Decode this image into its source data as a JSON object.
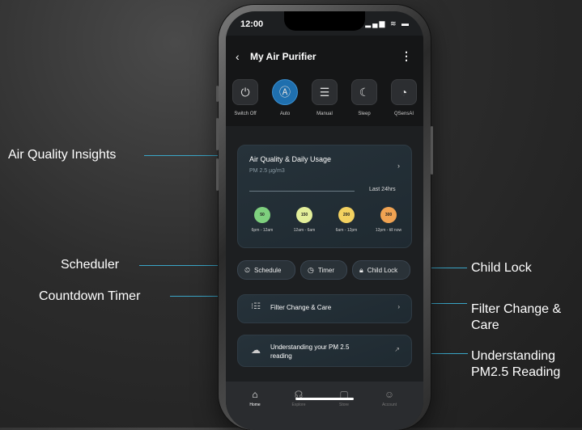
{
  "callouts": {
    "air_quality": "Air Quality Insights",
    "scheduler": "Scheduler",
    "countdown": "Countdown Timer",
    "child_lock": "Child Lock",
    "filter_line1": "Filter Change &",
    "filter_line2": "Care",
    "pm_line1": "Understanding",
    "pm_line2": "PM2.5 Reading"
  },
  "status": {
    "time": "12:00",
    "icons": "▂▄▆ ≋ ▬"
  },
  "header": {
    "back": "‹",
    "title": "My Air Purifier",
    "more": "⋮"
  },
  "modes": [
    {
      "label": "Switch Off",
      "icon": "⏻",
      "icon_name": "power-icon"
    },
    {
      "label": "Auto",
      "icon": "Ⓐ",
      "icon_name": "auto-icon"
    },
    {
      "label": "Manual",
      "icon": "☰",
      "icon_name": "sliders-icon"
    },
    {
      "label": "Sleep",
      "icon": "☾",
      "icon_name": "moon-icon"
    },
    {
      "label": "QSensAI",
      "icon": "◔",
      "icon_name": "qsensai-icon"
    }
  ],
  "air_quality": {
    "title": "Air Quality & Daily Usage",
    "subtitle": "PM 2.5 µg/m3",
    "range": "Last 24hrs",
    "arrow": "›",
    "readings": [
      {
        "value": "50",
        "label": "6pm - 12am",
        "color": "#7ed07e"
      },
      {
        "value": "150",
        "label": "12am - 6am",
        "color": "#e3ef9a"
      },
      {
        "value": "200",
        "label": "6am - 12pm",
        "color": "#f3d160"
      },
      {
        "value": "300",
        "label": "12pm - till now",
        "color": "#f0a352"
      }
    ]
  },
  "actions": {
    "schedule": "Schedule",
    "timer": "Timer",
    "child_lock": "Child Lock"
  },
  "filter_card": {
    "title": "Filter Change & Care",
    "arrow": "›"
  },
  "pm_card": {
    "title": "Understanding your PM 2.5 reading",
    "arrow": "↗"
  },
  "tabs": [
    {
      "label": "Home",
      "icon": "⌂"
    },
    {
      "label": "Explore",
      "icon": "☊"
    },
    {
      "label": "Store",
      "icon": "▢"
    },
    {
      "label": "Account",
      "icon": "☺"
    }
  ],
  "accent": "#3aa6c8"
}
